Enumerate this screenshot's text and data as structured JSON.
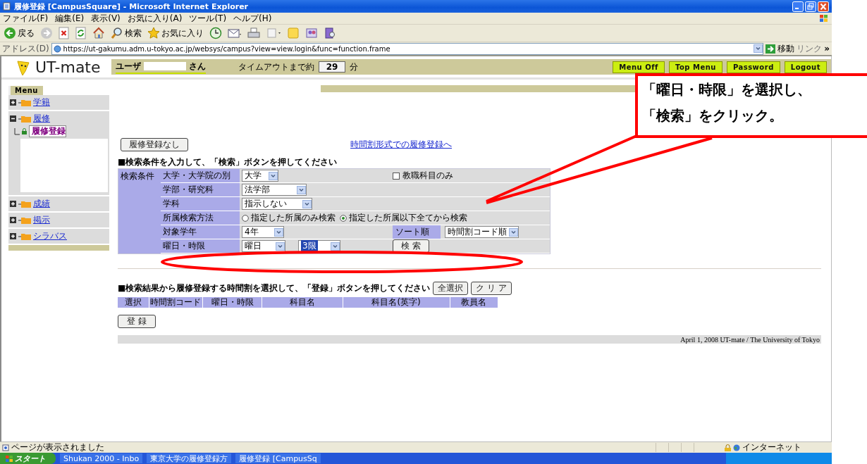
{
  "window": {
    "title": "履修登録 [CampusSquare] - Microsoft Internet Explorer"
  },
  "menu_bar": [
    "ファイル(F)",
    "編集(E)",
    "表示(V)",
    "お気に入り(A)",
    "ツール(T)",
    "ヘルプ(H)"
  ],
  "toolbar": [
    {
      "kind": "back",
      "label": "戻る"
    },
    {
      "kind": "forward"
    },
    {
      "kind": "stop"
    },
    {
      "kind": "refresh"
    },
    {
      "kind": "home"
    },
    {
      "kind": "search",
      "label": "検索"
    },
    {
      "kind": "favorites",
      "label": "お気に入り"
    },
    {
      "kind": "history"
    },
    {
      "kind": "mail"
    },
    {
      "kind": "print"
    },
    {
      "kind": "edit"
    },
    {
      "kind": "folder"
    },
    {
      "kind": "messenger"
    },
    {
      "kind": "research"
    }
  ],
  "address_bar": {
    "label": "アドレス(D)",
    "url": "https://ut-gakumu.adm.u-tokyo.ac.jp/websys/campus?view=view.login&func=function.frame",
    "go": "移動",
    "links": "リンク",
    "more": "»"
  },
  "header": {
    "logo": "UT-mate",
    "user_label": "ユーザ",
    "user_suffix": "さん",
    "timeout_label": "タイムアウトまで約",
    "timeout_value": "29",
    "timeout_unit": "分",
    "buttons": [
      "Menu Off",
      "Top Menu",
      "Password",
      "Logout"
    ]
  },
  "sidebar": {
    "title": "Menu",
    "items": [
      {
        "label": "学籍",
        "expanded": false
      },
      {
        "label": "履修",
        "expanded": true,
        "children": [
          {
            "label": "履修登録",
            "selected": true
          }
        ]
      },
      {
        "label": "成績",
        "expanded": false
      },
      {
        "label": "掲示",
        "expanded": false
      },
      {
        "label": "シラバス",
        "expanded": false
      }
    ]
  },
  "search": {
    "no_registration_button": "履修登録なし",
    "timetable_link": "時間割形式での履修登録へ",
    "heading": "■検索条件を入力して、「検索」ボタンを押してください",
    "criteria_label": "検索条件",
    "rows": [
      {
        "kind": "select",
        "label": "大学・大学院の別",
        "value": "大学",
        "checkbox": {
          "label": "教職科目のみ",
          "checked": false
        }
      },
      {
        "kind": "select",
        "label": "学部・研究科",
        "value": "法学部"
      },
      {
        "kind": "select",
        "label": "学科",
        "value": "指示しない"
      },
      {
        "kind": "radio",
        "label": "所属検索方法",
        "options": [
          {
            "label": "指定した所属のみ検索",
            "selected": false
          },
          {
            "label": "指定した所属以下全てから検索",
            "selected": true
          }
        ]
      },
      {
        "kind": "select",
        "label": "対象学年",
        "value": "4年",
        "sort": {
          "label": "ソート順",
          "value": "時間割コード順"
        }
      },
      {
        "kind": "day_period",
        "label": "曜日・時限",
        "value": "曜日",
        "period": "3限",
        "button": "検 索"
      }
    ]
  },
  "results": {
    "heading": "■検索結果から履修登録する時間割を選択して、「登録」ボタンを押してください",
    "select_all": "全選択",
    "clear": "ク リ ア",
    "columns": [
      "選択",
      "時間割コード",
      "曜日・時限",
      "科目名",
      "科目名(英字)",
      "教員名"
    ],
    "register_button": "登 録"
  },
  "footer": "April 1, 2008  UT-mate  /  The University of Tokyo",
  "status_bar": {
    "text": "ページが表示されました",
    "zone": "インターネット"
  },
  "taskbar": {
    "start": "スタート",
    "items": [
      "Shukan 2000 - Inbo",
      "東京大学の履修登録方",
      "履修登録 [CampusSq"
    ]
  },
  "annotation": {
    "lines": [
      "「曜日・時限」を選択し、",
      "「検索」をクリック。"
    ]
  }
}
